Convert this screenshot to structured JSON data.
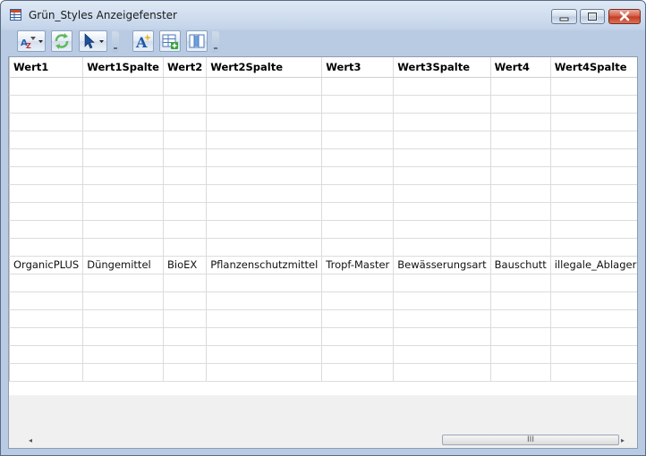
{
  "window": {
    "title": "Grün_Styles Anzeigefenster"
  },
  "toolbar": {
    "buttons": [
      {
        "icon": "sort-filter-icon"
      },
      {
        "icon": "refresh-icon"
      },
      {
        "icon": "pointer-select-icon"
      },
      {
        "icon": "text-style-icon"
      },
      {
        "icon": "add-row-icon"
      },
      {
        "icon": "columns-icon"
      }
    ]
  },
  "grid": {
    "columns": [
      "Wert1",
      "Wert1Spalte",
      "Wert2",
      "Wert2Spalte",
      "Wert3",
      "Wert3Spalte",
      "Wert4",
      "Wert4Spalte"
    ],
    "filled_row": [
      "OrganicPLUS",
      "Düngemittel",
      "BioEX",
      "Pflanzenschutzmittel",
      "Tropf-Master",
      "Bewässerungsart",
      "Bauschutt",
      "illegale_Ablagerungen"
    ]
  },
  "scrollbar": {
    "thumb_glyph": "III",
    "left_arrow": "◂",
    "right_arrow": "▸"
  }
}
